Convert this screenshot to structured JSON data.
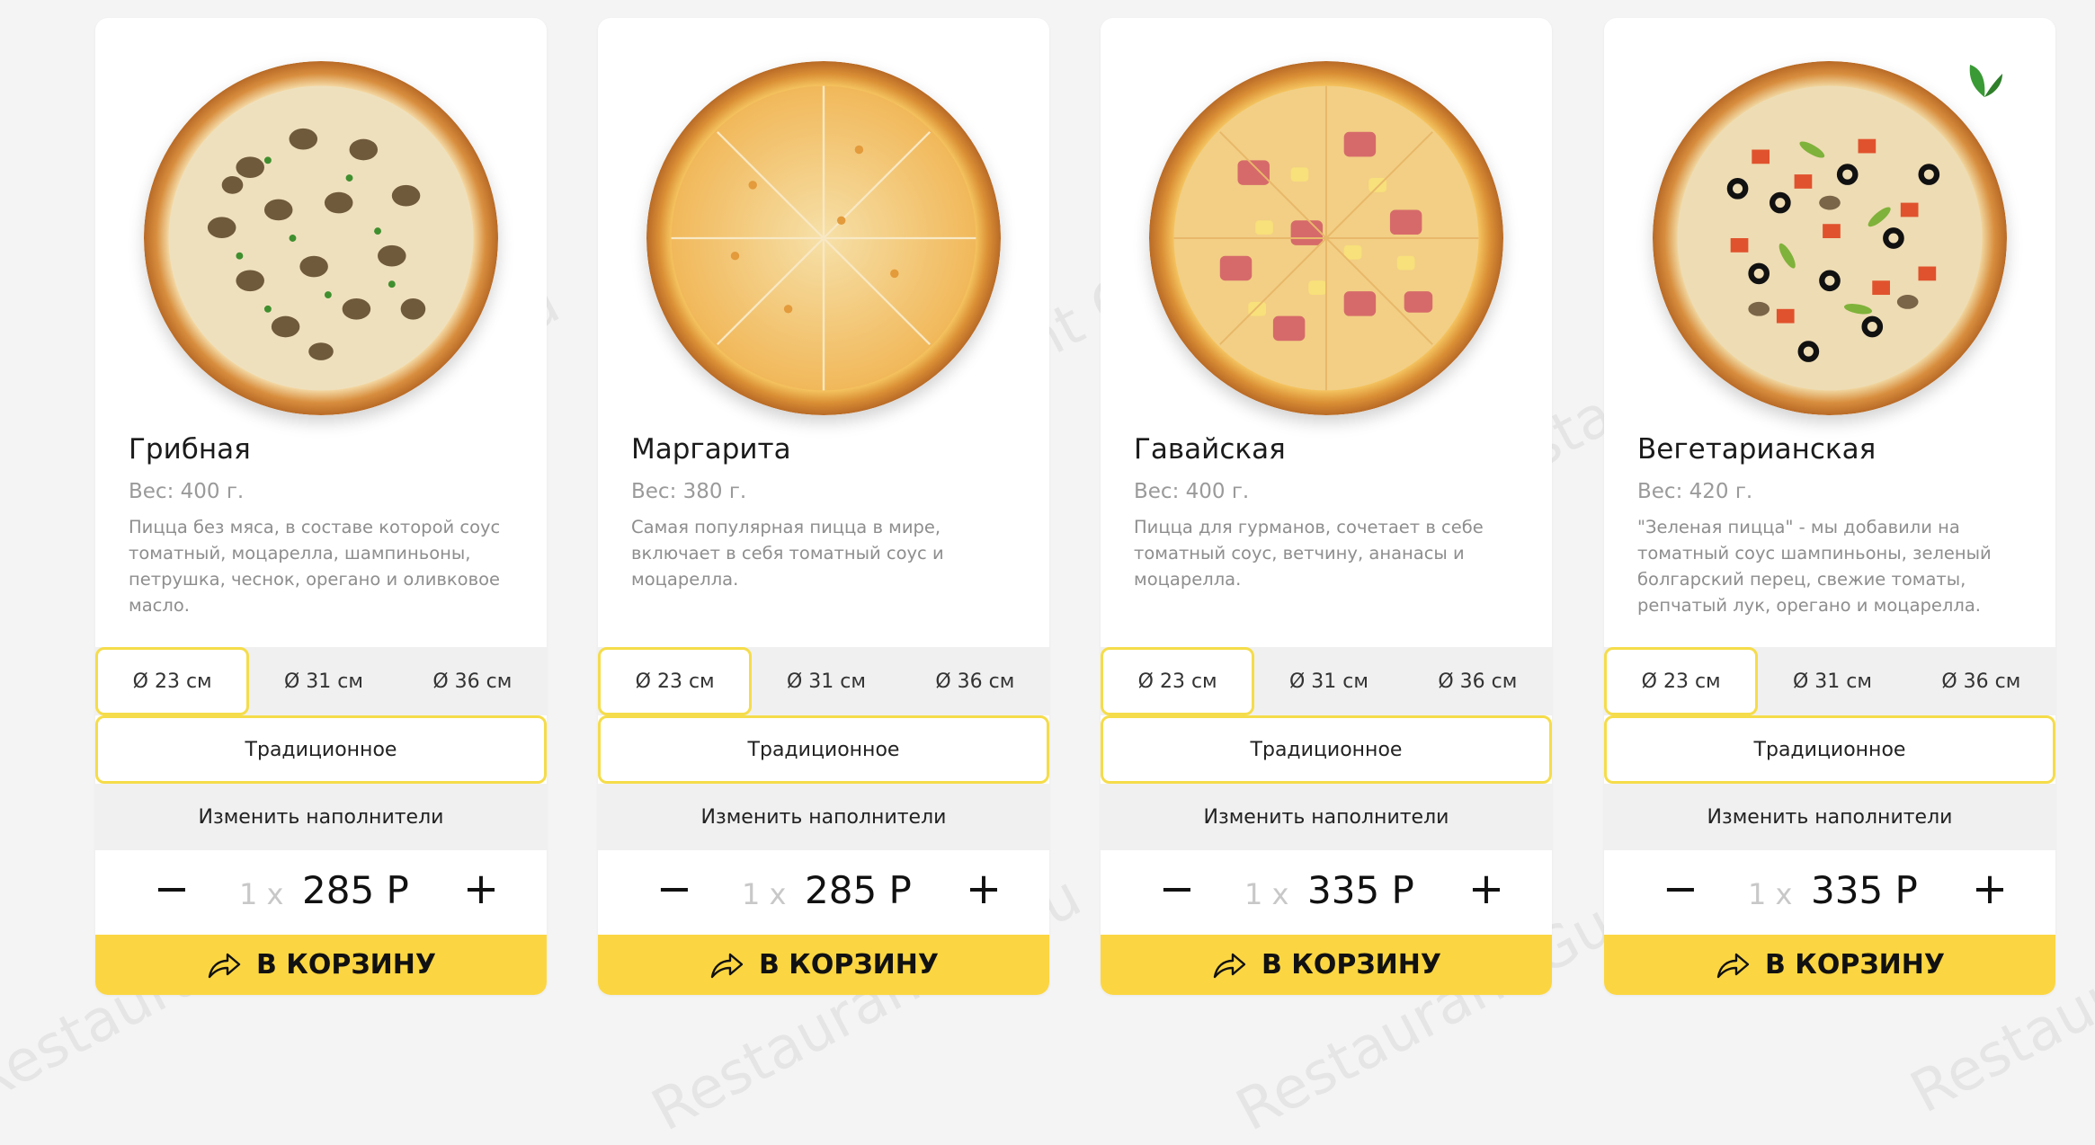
{
  "watermark_text": "Restaurant Guru",
  "products": [
    {
      "title": "Грибная",
      "weight": "Вес: 400 г.",
      "description": "Пицца без мяса, в составе которой соус томатный, моцарелла, шампиньоны, петрушка, чеснок, орегано и оливковое масло.",
      "sizes": [
        "Ø 23 см",
        "Ø 31 см",
        "Ø 36 см"
      ],
      "selected_size": "Ø 23 см",
      "crust": "Традиционное",
      "toppings_button": "Изменить наполнители",
      "qty": "1 x",
      "price": "285 Р",
      "cart_button": "В КОРЗИНУ",
      "pizza_icon": "mushroom-pizza-image"
    },
    {
      "title": "Маргарита",
      "weight": "Вес: 380 г.",
      "description": "Самая популярная пицца в мире, включает в себя томатный соус и моцарелла.",
      "sizes": [
        "Ø 23 см",
        "Ø 31 см",
        "Ø 36 см"
      ],
      "selected_size": "Ø 23 см",
      "crust": "Традиционное",
      "toppings_button": "Изменить наполнители",
      "qty": "1 x",
      "price": "285 Р",
      "cart_button": "В КОРЗИНУ",
      "pizza_icon": "margherita-pizza-image"
    },
    {
      "title": "Гавайская",
      "weight": "Вес: 400 г.",
      "description": "Пицца для гурманов, сочетает в себе томатный соус, ветчину, ананасы и моцарелла.",
      "sizes": [
        "Ø 23 см",
        "Ø 31 см",
        "Ø 36 см"
      ],
      "selected_size": "Ø 23 см",
      "crust": "Традиционное",
      "toppings_button": "Изменить наполнители",
      "qty": "1 x",
      "price": "335 Р",
      "cart_button": "В КОРЗИНУ",
      "pizza_icon": "hawaiian-pizza-image"
    },
    {
      "title": "Вегетарианская",
      "weight": "Вес: 420 г.",
      "description": "\"Зеленая пицца\" - мы добавили на томатный соус шампиньоны, зеленый болгарский перец, свежие томаты, репчатый лук, орегано и моцарелла.",
      "sizes": [
        "Ø 23 см",
        "Ø 31 см",
        "Ø 36 см"
      ],
      "selected_size": "Ø 23 см",
      "crust": "Традиционное",
      "toppings_button": "Изменить наполнители",
      "qty": "1 x",
      "price": "335 Р",
      "cart_button": "В КОРЗИНУ",
      "pizza_icon": "vegetarian-pizza-image",
      "badge_icon": "leaf-icon"
    }
  ],
  "colors": {
    "accent": "#fbd642",
    "border_accent": "#f5dc4a",
    "background": "#f4f4f4",
    "muted_text": "#8e8e8e"
  }
}
